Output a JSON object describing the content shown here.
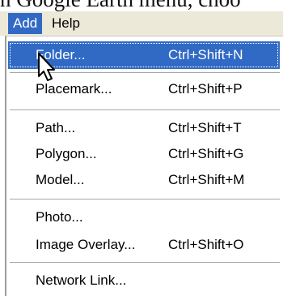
{
  "background": {
    "text": "n Google Earth menu, choo"
  },
  "menubar": {
    "items": [
      {
        "label": "Add"
      },
      {
        "label": "Help"
      }
    ]
  },
  "menu": {
    "items": [
      {
        "label": "Folder...",
        "shortcut": "Ctrl+Shift+N"
      },
      {
        "label": "Placemark...",
        "shortcut": "Ctrl+Shift+P"
      },
      {
        "label": "Path...",
        "shortcut": "Ctrl+Shift+T"
      },
      {
        "label": "Polygon...",
        "shortcut": "Ctrl+Shift+G"
      },
      {
        "label": "Model...",
        "shortcut": "Ctrl+Shift+M"
      },
      {
        "label": "Photo...",
        "shortcut": ""
      },
      {
        "label": "Image Overlay...",
        "shortcut": "Ctrl+Shift+O"
      },
      {
        "label": "Network Link...",
        "shortcut": ""
      }
    ]
  },
  "colors": {
    "highlight": "#316ac5",
    "menubar_bg": "#ece9d8",
    "menu_bg": "#ffffff"
  },
  "icons": {
    "cursor": "arrow-cursor-icon"
  }
}
